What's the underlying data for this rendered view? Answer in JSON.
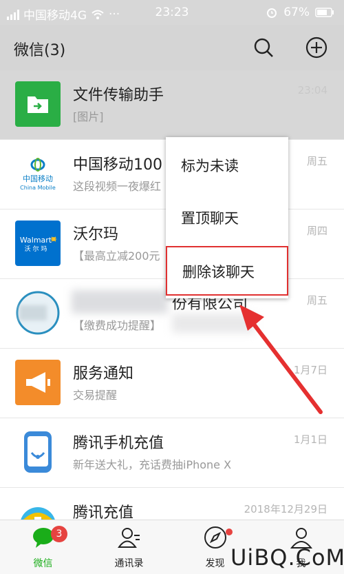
{
  "status_bar": {
    "carrier": "中国移动4G",
    "time": "23:23",
    "battery": "67%",
    "more": "···"
  },
  "header": {
    "title": "微信(3)"
  },
  "chats": [
    {
      "name": "文件传输助手",
      "preview": "[图片]",
      "time": "23:04"
    },
    {
      "name": "中国移动100",
      "preview": "这段视频一夜爆红",
      "time": "周五",
      "avatar_text_cn": "中国移动",
      "avatar_text_en": "China Mobile"
    },
    {
      "name": "沃尔玛",
      "preview": "【最高立减200元",
      "time": "周四",
      "avatar_text_en": "Walmart",
      "avatar_text_cn": "沃 尔 玛"
    },
    {
      "name": "份有限公司",
      "preview": "【缴费成功提醒】",
      "time": "周五"
    },
    {
      "name": "服务通知",
      "preview": "交易提醒",
      "time": "1月7日"
    },
    {
      "name": "腾讯手机充值",
      "preview": "新年送大礼，充话费抽iPhone X",
      "time": "1月1日"
    },
    {
      "name": "腾讯充值",
      "preview": "",
      "time": "2018年12月29日"
    }
  ],
  "popup_menu": {
    "items": [
      "标为未读",
      "置顶聊天",
      "删除该聊天"
    ]
  },
  "tab_bar": {
    "tabs": [
      {
        "label": "微信",
        "badge": "3"
      },
      {
        "label": "通讯录"
      },
      {
        "label": "发现"
      },
      {
        "label": "我"
      }
    ]
  },
  "watermark": "UiBQ.CoM",
  "colors": {
    "accent": "#1aad19",
    "badge": "#e64340",
    "highlight": "#e03030"
  }
}
